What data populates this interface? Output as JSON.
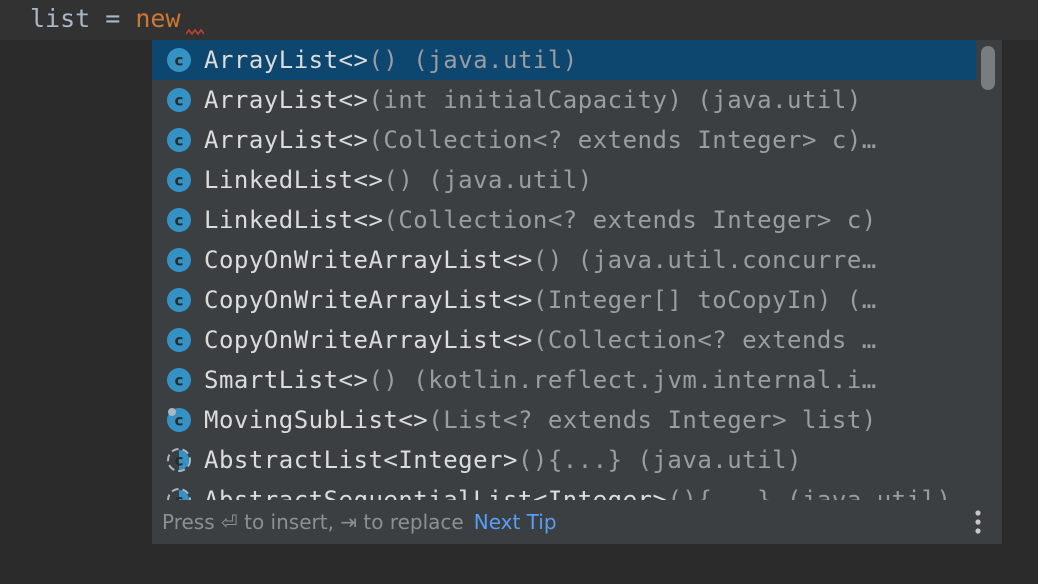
{
  "editor": {
    "code_var": "list",
    "code_op": " = ",
    "code_kw": "new"
  },
  "completion": {
    "items": [
      {
        "name": "ArrayList<>",
        "tail": "() (java.util)",
        "icon": "class-icon",
        "selected": true
      },
      {
        "name": "ArrayList<>",
        "tail": "(int initialCapacity) (java.util)",
        "icon": "class-icon",
        "selected": false
      },
      {
        "name": "ArrayList<>",
        "tail": "(Collection<? extends Integer> c)…",
        "icon": "class-icon",
        "selected": false
      },
      {
        "name": "LinkedList<>",
        "tail": "() (java.util)",
        "icon": "class-icon",
        "selected": false
      },
      {
        "name": "LinkedList<>",
        "tail": "(Collection<? extends Integer> c)",
        "icon": "class-icon",
        "selected": false
      },
      {
        "name": "CopyOnWriteArrayList<>",
        "tail": "() (java.util.concurre…",
        "icon": "class-icon",
        "selected": false
      },
      {
        "name": "CopyOnWriteArrayList<>",
        "tail": "(Integer[] toCopyIn) (…",
        "icon": "class-icon",
        "selected": false
      },
      {
        "name": "CopyOnWriteArrayList<>",
        "tail": "(Collection<? extends …",
        "icon": "class-icon",
        "selected": false
      },
      {
        "name": "SmartList<>",
        "tail": "() (kotlin.reflect.jvm.internal.i…",
        "icon": "class-icon",
        "selected": false
      },
      {
        "name": "MovingSubList<>",
        "tail": "(List<? extends Integer> list)",
        "icon": "inner-class-icon",
        "selected": false
      },
      {
        "name": "AbstractList<Integer>",
        "tail": "(){...} (java.util)",
        "icon": "abstract-class-icon",
        "selected": false
      },
      {
        "name": "AbstractSequentialList<Integer>",
        "tail": "(){...} (java.util)",
        "icon": "abstract-class-icon",
        "selected": false
      }
    ],
    "footer": {
      "hint": "Press ⏎ to insert, ⇥ to replace",
      "link": "Next Tip"
    }
  },
  "colors": {
    "editor_bg": "#2b2b2b",
    "popup_bg": "#3c3f41",
    "selection": "#0d466f",
    "keyword": "#cc7832",
    "link": "#589df6",
    "class_icon": "#3592c4"
  }
}
